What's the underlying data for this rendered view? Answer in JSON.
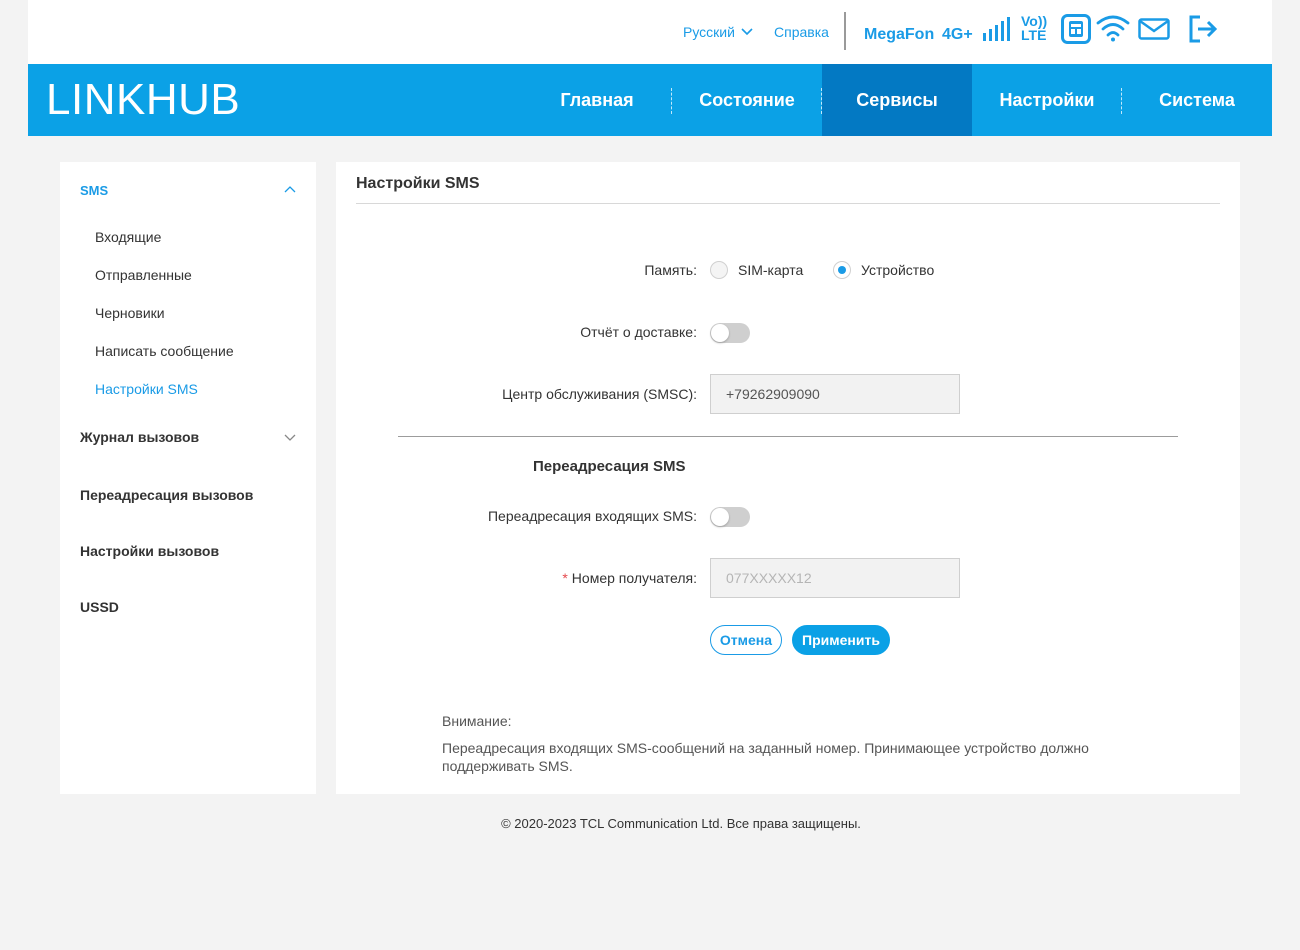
{
  "header": {
    "language": "Русский",
    "help": "Справка",
    "operator": "MegaFon",
    "network_type": "4G+",
    "volte_top": "Vo))",
    "volte_bottom": "LTE"
  },
  "logo": {
    "bold": "LINK",
    "light": "HUB"
  },
  "nav": {
    "items": [
      {
        "label": "Главная"
      },
      {
        "label": "Состояние"
      },
      {
        "label": "Сервисы",
        "active": true
      },
      {
        "label": "Настройки"
      },
      {
        "label": "Система"
      }
    ]
  },
  "sidebar": {
    "sms_header": "SMS",
    "sms_items": [
      {
        "label": "Входящие"
      },
      {
        "label": "Отправленные"
      },
      {
        "label": "Черновики"
      },
      {
        "label": "Написать сообщение"
      },
      {
        "label": "Настройки SMS",
        "active": true
      }
    ],
    "call_log": "Журнал вызовов",
    "call_forwarding": "Переадресация вызовов",
    "call_settings": "Настройки вызовов",
    "ussd": "USSD"
  },
  "main": {
    "title": "Настройки SMS",
    "storage_label": "Память:",
    "storage_options": [
      "SIM-карта",
      "Устройство"
    ],
    "storage_selected": "Устройство",
    "delivery_report_label": "Отчёт о доставке:",
    "delivery_report_on": false,
    "smsc_label": "Центр обслуживания (SMSC):",
    "smsc_value": "+79262909090",
    "forward_section_title": "Переадресация SMS",
    "forward_incoming_label": "Переадресация входящих SMS:",
    "forward_incoming_on": false,
    "recipient_required_mark": "*",
    "recipient_label": "Номер получателя:",
    "recipient_placeholder": "077XXXXX12",
    "cancel_button": "Отмена",
    "apply_button": "Применить",
    "note_title": "Внимание:",
    "note_text": "Переадресация входящих SMS-сообщений на заданный номер. Принимающее устройство должно поддерживать SMS."
  },
  "footer": {
    "copyright": "© 2020-2023 TCL Communication Ltd. Все права защищены."
  },
  "colors": {
    "accent": "#0ba1e6",
    "active_nav": "#0379c3",
    "link": "#1a9be6",
    "background": "#f3f3f3"
  }
}
